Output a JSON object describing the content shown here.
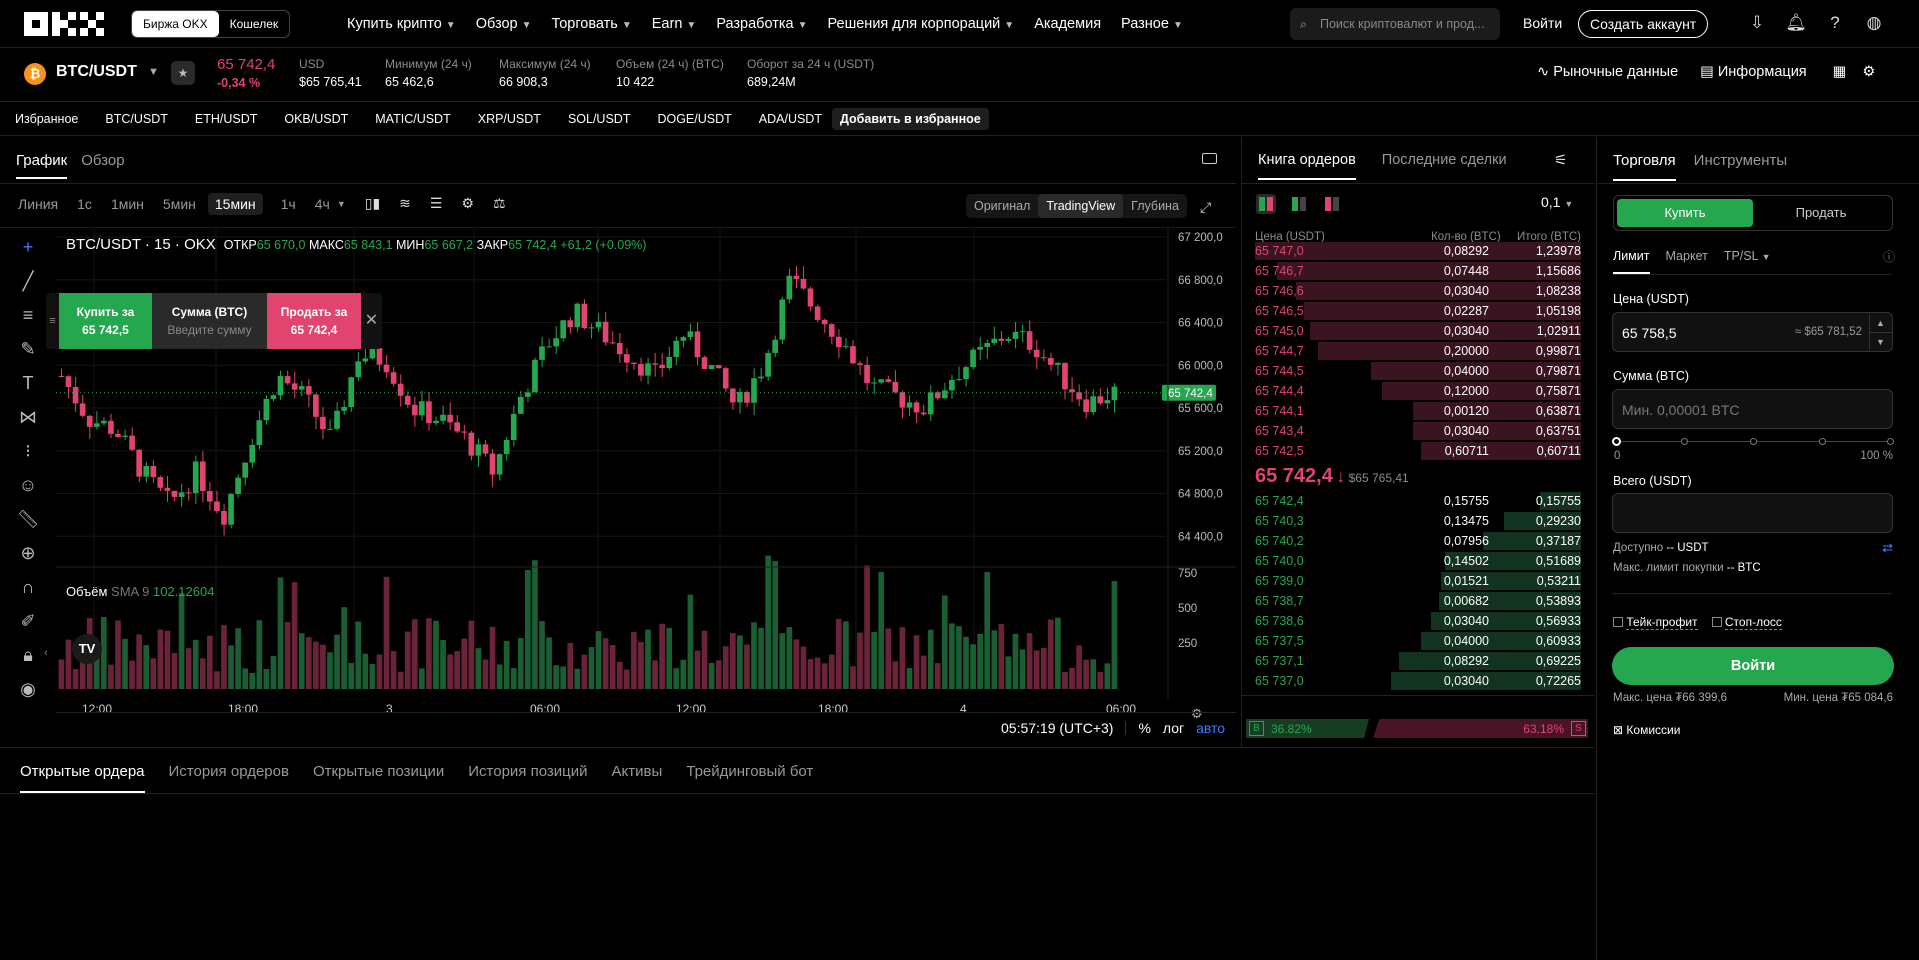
{
  "nav": {
    "exchange_label": "Биржа OKX",
    "wallet_label": "Кошелек",
    "menu": [
      "Купить крипто",
      "Обзор",
      "Торговать",
      "Earn",
      "Разработка",
      "Решения для корпораций",
      "Академия",
      "Разное"
    ],
    "search_placeholder": "Поиск криптовалют и прод...",
    "login": "Войти",
    "signup": "Создать аккаунт"
  },
  "ticker": {
    "pair": "BTC/USDT",
    "price": "65 742,4",
    "change": "-0,34 %",
    "usd_label": "USD",
    "usd_value": "$65 765,41",
    "low_label": "Минимум (24 ч)",
    "low_value": "65 462,6",
    "high_label": "Максимум (24 ч)",
    "high_value": "66 908,3",
    "vol_label": "Объем (24 ч) (BTC)",
    "vol_value": "10 422",
    "turnover_label": "Оборот за 24 ч (USDT)",
    "turnover_value": "689,24M",
    "market_data": "Рыночные данные",
    "info": "Информация"
  },
  "favorites": {
    "label": "Избранное",
    "pairs": [
      "BTC/USDT",
      "ETH/USDT",
      "OKB/USDT",
      "MATIC/USDT",
      "XRP/USDT",
      "SOL/USDT",
      "DOGE/USDT",
      "ADA/USDT"
    ],
    "add": "Добавить в избранное"
  },
  "chart": {
    "tabs": [
      "График",
      "Обзор"
    ],
    "intervals": [
      "Линия",
      "1с",
      "1мин",
      "5мин",
      "15мин",
      "1ч",
      "4ч"
    ],
    "views": [
      "Оригинал",
      "TradingView",
      "Глубина"
    ],
    "legend_title": "BTC/USDT · 15 · OKX",
    "open_label": "ОТКР",
    "open": "65 670,0",
    "high_label": "МАКС",
    "high": "65 843,1",
    "low_label": "МИН",
    "low": "65 667,2",
    "close_label": "ЗАКР",
    "close": "65 742,4",
    "delta": "+61,2 (+0.09%)",
    "quick_buy": "Купить за",
    "quick_buy_price": "65 742,5",
    "quick_amount": "Сумма (BTC)",
    "quick_amount_ph": "Введите сумму",
    "quick_sell": "Продать за",
    "quick_sell_price": "65 742,4",
    "price_ticks": [
      "67 200,0",
      "66 800,0",
      "66 400,0",
      "66 000,0",
      "65 600,0",
      "65 200,0",
      "64 800,0",
      "64 400,0"
    ],
    "last_price_label": "65 742,4",
    "volume_label": "Объём",
    "sma_label": "SMA 9",
    "sma_value": "102.12604",
    "vol_ticks": [
      "750",
      "500",
      "250"
    ],
    "time_ticks": [
      "12:00",
      "18:00",
      "3",
      "06:00",
      "12:00",
      "18:00",
      "4",
      "06:00"
    ],
    "clock": "05:57:19 (UTC+3)",
    "pct": "%",
    "log": "лог",
    "auto": "авто"
  },
  "chart_data": {
    "type": "candlestick",
    "interval": "15m",
    "ylim": [
      64300,
      67200
    ],
    "last": 65742.4,
    "open": 65670.0,
    "high": 65843.1,
    "low": 65667.2,
    "close": 65742.4
  },
  "orderbook": {
    "tabs": [
      "Книга ордеров",
      "Последние сделки"
    ],
    "step": "0,1",
    "headers": [
      "Цена (USDT)",
      "Кол-во (BTC)",
      "Итого (BTC)"
    ],
    "asks": [
      [
        "65 747,0",
        "0,08292",
        "1,23978"
      ],
      [
        "65 746,7",
        "0,07448",
        "1,15686"
      ],
      [
        "65 746,6",
        "0,03040",
        "1,08238"
      ],
      [
        "65 746,5",
        "0,02287",
        "1,05198"
      ],
      [
        "65 745,0",
        "0,03040",
        "1,02911"
      ],
      [
        "65 744,7",
        "0,20000",
        "0,99871"
      ],
      [
        "65 744,5",
        "0,04000",
        "0,79871"
      ],
      [
        "65 744,4",
        "0,12000",
        "0,75871"
      ],
      [
        "65 744,1",
        "0,00120",
        "0,63871"
      ],
      [
        "65 743,4",
        "0,03040",
        "0,63751"
      ],
      [
        "65 742,5",
        "0,60711",
        "0,60711"
      ]
    ],
    "mid_price": "65 742,4",
    "mid_usd": "$65 765,41",
    "bids": [
      [
        "65 742,4",
        "0,15755",
        "0,15755"
      ],
      [
        "65 740,3",
        "0,13475",
        "0,29230"
      ],
      [
        "65 740,2",
        "0,07956",
        "0,37187"
      ],
      [
        "65 740,0",
        "0,14502",
        "0,51689"
      ],
      [
        "65 739,0",
        "0,01521",
        "0,53211"
      ],
      [
        "65 738,7",
        "0,00682",
        "0,53893"
      ],
      [
        "65 738,6",
        "0,03040",
        "0,56933"
      ],
      [
        "65 737,5",
        "0,04000",
        "0,60933"
      ],
      [
        "65 737,1",
        "0,08292",
        "0,69225"
      ],
      [
        "65 737,0",
        "0,03040",
        "0,72265"
      ]
    ],
    "buy_pct": "36.82%",
    "sell_pct": "63.18%",
    "b": "B",
    "s": "S"
  },
  "trade": {
    "tabs": [
      "Торговля",
      "Инструменты"
    ],
    "buy": "Купить",
    "sell": "Продать",
    "types": [
      "Лимит",
      "Маркет",
      "TP/SL"
    ],
    "price_label": "Цена (USDT)",
    "price_value": "65 758,5",
    "price_approx": "≈ $65 781,52",
    "amount_label": "Сумма (BTC)",
    "amount_ph": "Мин. 0,00001 BTC",
    "slider_min": "0",
    "slider_max": "100 %",
    "total_label": "Всего (USDT)",
    "avail_label": "Доступно",
    "avail_value": "-- USDT",
    "maxbuy_label": "Макс. лимит покупки",
    "maxbuy_value": "-- BTC",
    "tp": "Тейк-профит",
    "sl": "Стоп-лосс",
    "submit": "Войти",
    "maxprice": "Макс. цена ₮66 399,6",
    "minprice": "Мин. цена ₮65 084,6",
    "fees": "Комиссии"
  },
  "bottom": {
    "tabs": [
      "Открытые ордера",
      "История ордеров",
      "Открытые позиции",
      "История позиций",
      "Активы",
      "Трейдинговый бот"
    ]
  }
}
